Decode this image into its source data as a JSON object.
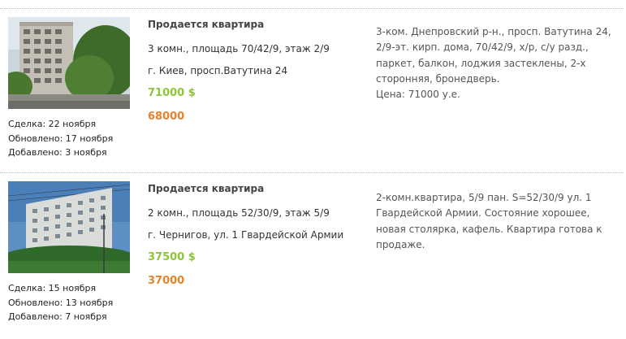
{
  "listings": [
    {
      "title": "Продается квартира",
      "details": "3 комн., площадь 70/42/9, этаж 2/9",
      "address": "г. Киев, просп.Ватутина 24",
      "price_main": "71000 $",
      "price_alt": "68000",
      "description": "3-ком. Днепровский р-н., просп. Ватутина 24, 2/9-эт. кирп. дома, 70/42/9, х/р, с/у разд., паркет, балкон, лоджия застеклены, 2-х сторонняя, бронедверь.",
      "description_price": "Цена: 71000 у.е.",
      "dates": {
        "deal": "Сделка: 22 ноября",
        "updated": "Обновлено: 17 ноября",
        "added": "Добавлено: 3 ноября"
      },
      "photo_icon": "apartment-building-photo"
    },
    {
      "title": "Продается квартира",
      "details": "2 комн., площадь 52/30/9, этаж 5/9",
      "address": "г. Чернигов, ул. 1 Гвардейской Армии",
      "price_main": "37500 $",
      "price_alt": "37000",
      "description": "2-комн.квартира, 5/9 пан. S=52/30/9 ул. 1 Гвардейской Армии. Состояние хорошее, новая столярка, кафель. Квартира готова к продаже.",
      "description_price": "",
      "dates": {
        "deal": "Сделка: 15 ноября",
        "updated": "Обновлено: 13 ноября",
        "added": "Добавлено: 7 ноября"
      },
      "photo_icon": "apartment-building-photo"
    }
  ],
  "colors": {
    "price_main": "#8ec43a",
    "price_alt": "#e7822c",
    "separator": "#bfbfbf"
  }
}
